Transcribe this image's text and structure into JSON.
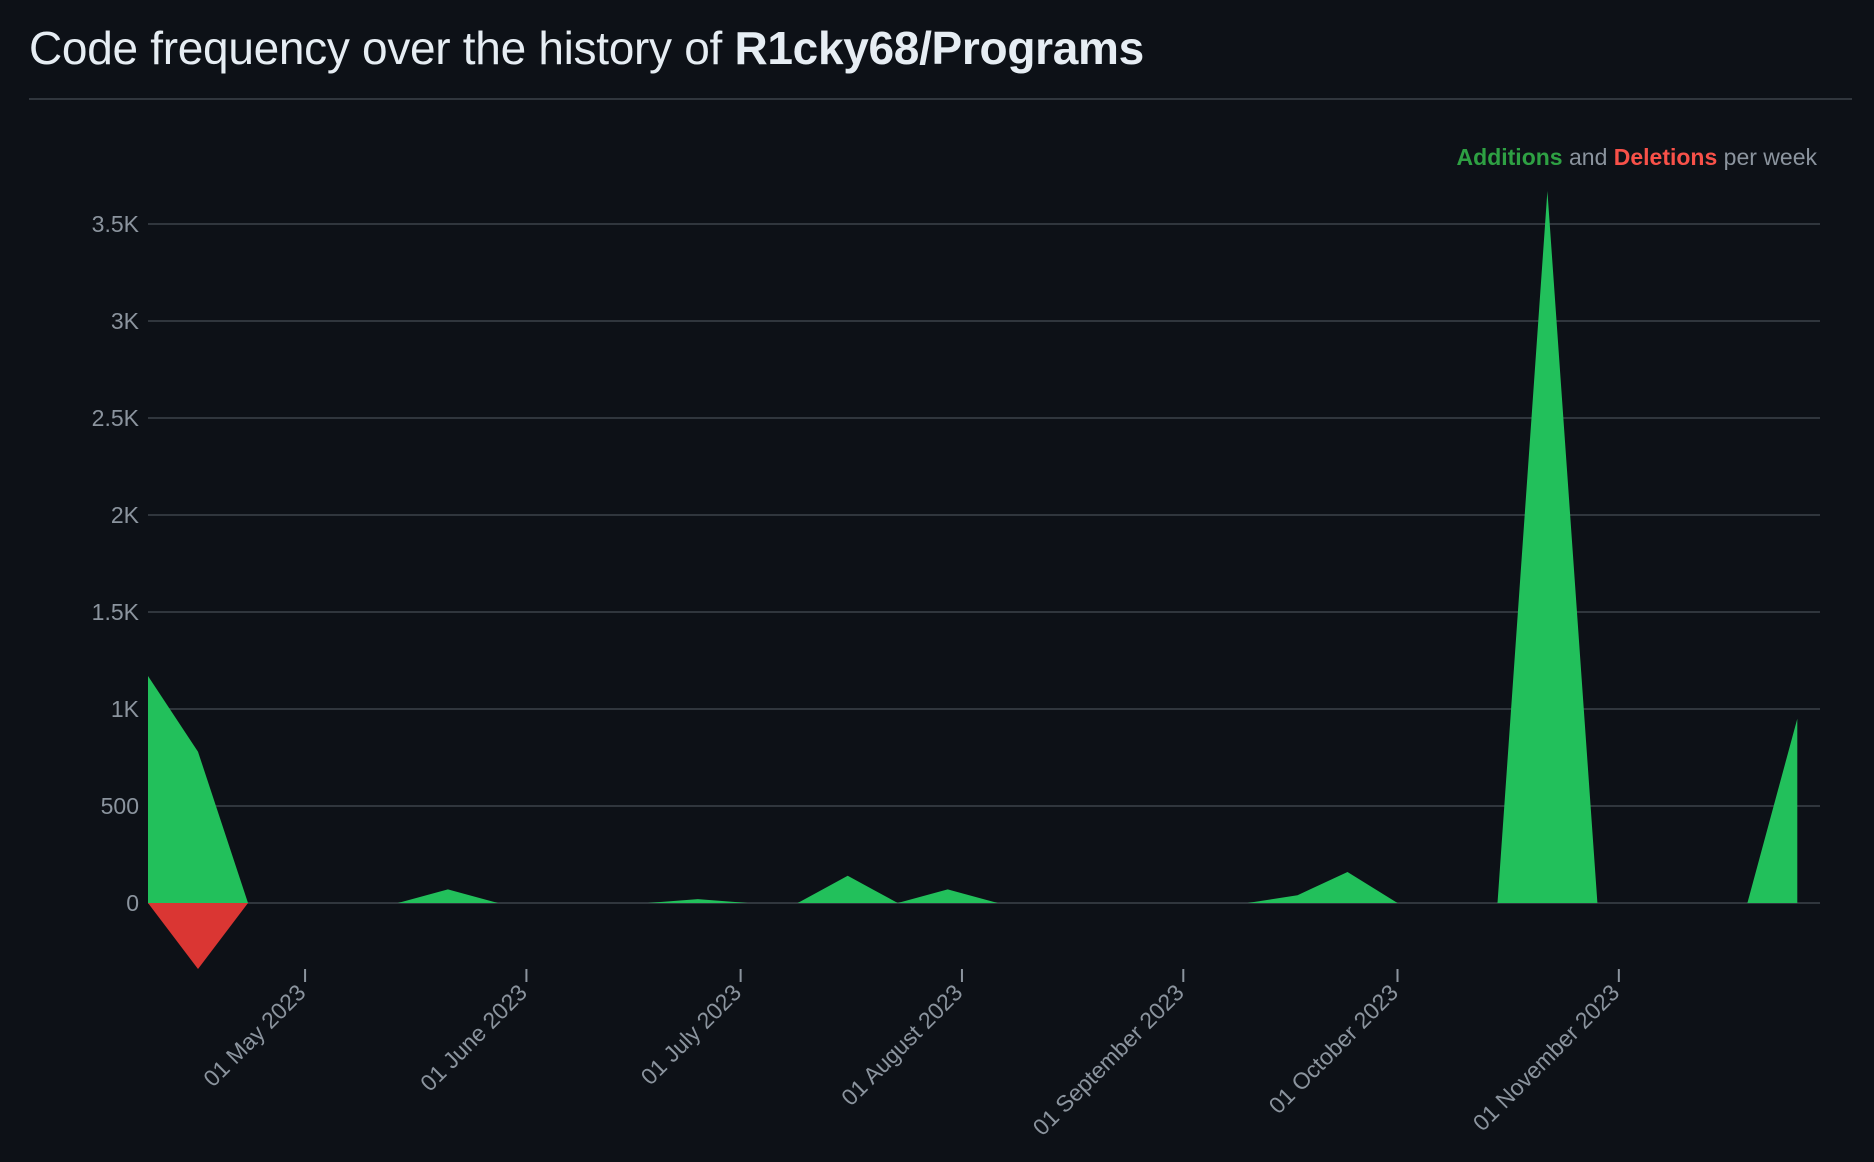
{
  "header": {
    "title_prefix": "Code frequency over the history of ",
    "repo": "R1cky68/Programs"
  },
  "legend": {
    "additions": "Additions",
    "and": " and ",
    "deletions": "Deletions",
    "suffix": " per week"
  },
  "colors": {
    "background": "#0d1117",
    "additions": "#22c05b",
    "deletions": "#da3633",
    "grid": "#30363d",
    "axis_text": "#8b949e"
  },
  "chart_data": {
    "type": "area",
    "title": "",
    "xlabel": "",
    "ylabel": "",
    "ylim": [
      -350,
      3850
    ],
    "yticks": [
      0,
      500,
      1000,
      1500,
      2000,
      2500,
      3000,
      3500
    ],
    "ytick_labels": [
      "0",
      "500",
      "1K",
      "1.5K",
      "2K",
      "2.5K",
      "3K",
      "3.5K"
    ],
    "xticks": [
      "2023-05-01",
      "2023-06-01",
      "2023-07-01",
      "2023-08-01",
      "2023-09-01",
      "2023-10-01",
      "2023-11-01"
    ],
    "xtick_labels": [
      "01 May 2023",
      "01 June 2023",
      "01 July 2023",
      "01 August 2023",
      "01 September 2023",
      "01 October 2023",
      "01 November 2023"
    ],
    "x": [
      "2023-04-09",
      "2023-04-16",
      "2023-04-23",
      "2023-04-30",
      "2023-05-07",
      "2023-05-14",
      "2023-05-21",
      "2023-05-28",
      "2023-06-04",
      "2023-06-11",
      "2023-06-18",
      "2023-06-25",
      "2023-07-02",
      "2023-07-09",
      "2023-07-16",
      "2023-07-23",
      "2023-07-30",
      "2023-08-06",
      "2023-08-13",
      "2023-08-20",
      "2023-08-27",
      "2023-09-03",
      "2023-09-10",
      "2023-09-17",
      "2023-09-24",
      "2023-10-01",
      "2023-10-08",
      "2023-10-15",
      "2023-10-22",
      "2023-10-29",
      "2023-11-05",
      "2023-11-12",
      "2023-11-19",
      "2023-11-26"
    ],
    "series": [
      {
        "name": "Additions",
        "values": [
          1170,
          780,
          0,
          0,
          0,
          0,
          70,
          0,
          0,
          0,
          0,
          20,
          0,
          0,
          140,
          0,
          70,
          0,
          0,
          0,
          0,
          0,
          0,
          40,
          160,
          0,
          0,
          0,
          3670,
          0,
          0,
          0,
          0,
          950
        ]
      },
      {
        "name": "Deletions",
        "values": [
          0,
          -340,
          0,
          0,
          0,
          0,
          0,
          0,
          0,
          0,
          0,
          0,
          0,
          0,
          0,
          0,
          0,
          0,
          0,
          0,
          0,
          0,
          0,
          0,
          0,
          0,
          0,
          0,
          0,
          0,
          0,
          0,
          0,
          0
        ]
      }
    ],
    "grid": true,
    "legend_position": "top-right"
  }
}
